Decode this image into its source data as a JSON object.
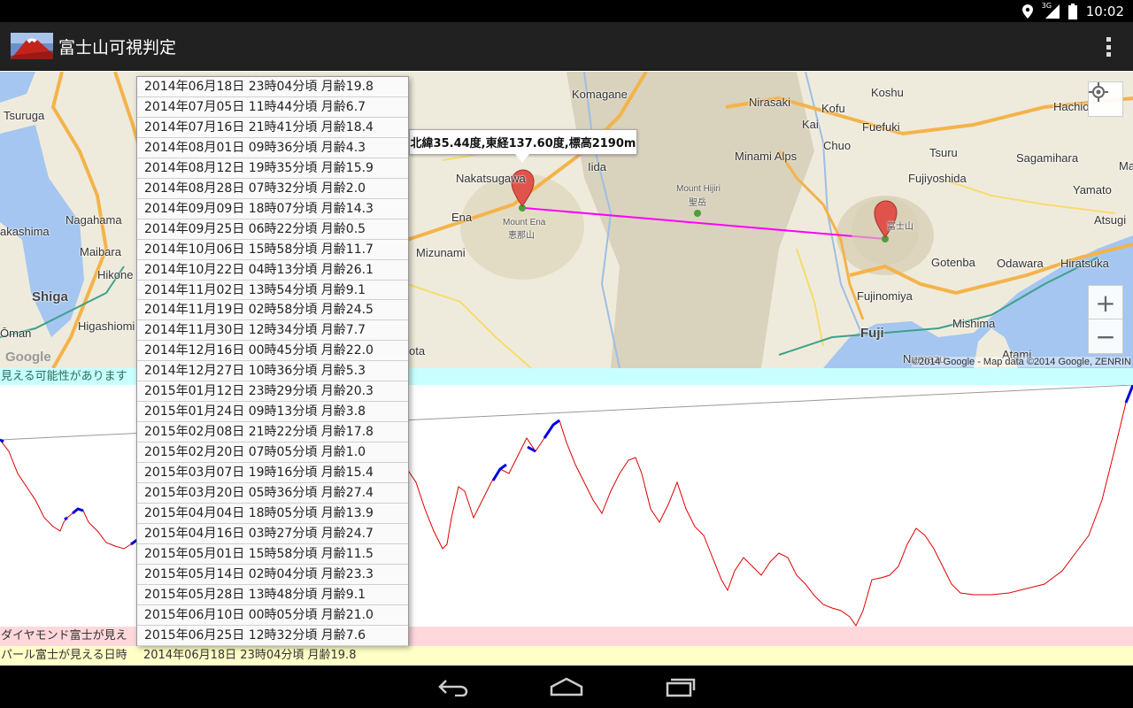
{
  "status_bar": {
    "time": "10:02",
    "network_label": "3G",
    "icons": [
      "location-icon",
      "signal-icon",
      "battery-icon"
    ]
  },
  "app_bar": {
    "title": "富士山可視判定",
    "icons": [
      "app-logo-icon",
      "overflow-menu-icon"
    ]
  },
  "map": {
    "info_window": "北緯35.44度,東経137.60度,標高2190m",
    "labels": {
      "tsuruga": "Tsuruga",
      "nagahama": "Nagahama",
      "akashima": "akashima",
      "maibara": "Maibara",
      "hikone": "Hikone",
      "shiga": "Shiga",
      "higashiomi": "Higashiomi",
      "oman": "Ōman",
      "komagane": "Komagane",
      "iida": "Iida",
      "nakatsugawa": "Nakatsugawa",
      "ena": "Ena",
      "mizunami": "Mizunami",
      "mount_ena": "Mount Ena",
      "mount_ena_jp": "恵那山",
      "ota": "ota",
      "nirasaki": "Nirasaki",
      "minami_alps": "Minami Alps",
      "mount_hijiri": "Mount Hijiri",
      "hijiri_jp": "聖岳",
      "koshu": "Koshu",
      "kofu": "Kofu",
      "fuefuki": "Fuefuki",
      "kai": "Kai",
      "chuo": "Chuo",
      "tsuru": "Tsuru",
      "fujiyoshida": "Fujiyoshida",
      "gotenba": "Gotenba",
      "fujinomiya": "Fujinomiya",
      "fuji": "Fuji",
      "numazu": "Numazu",
      "mishima": "Mishima",
      "atami": "Atami",
      "odawara": "Odawara",
      "hiratsuka": "Hiratsuka",
      "atsugi": "Atsugi",
      "yamato": "Yamato",
      "sagamihara": "Sagamihara",
      "hachio": "Hachio",
      "ma": "Ma",
      "mount_fuji_jp": "富士山"
    },
    "google_logo": "Google",
    "attribution": "©2014 Google - Map data ©2014 Google, ZENRIN",
    "zoom_in_label": "+",
    "zoom_out_label": "−",
    "accent_line_color": "#ff00ff"
  },
  "strips": {
    "visible": "見える可能性があります",
    "diamond": "ダイヤモンド富士が見え",
    "pearl_label": "パール富士が見える日時",
    "pearl_value": "2014年06月18日 23時04分頃 月齢19.8"
  },
  "dropdown_items": [
    "2014年06月18日 23時04分頃 月齢19.8",
    "2014年07月05日 11時44分頃 月齢6.7",
    "2014年07月16日 21時41分頃 月齢18.4",
    "2014年08月01日 09時36分頃 月齢4.3",
    "2014年08月12日 19時35分頃 月齢15.9",
    "2014年08月28日 07時32分頃 月齢2.0",
    "2014年09月09日 18時07分頃 月齢14.3",
    "2014年09月25日 06時22分頃 月齢0.5",
    "2014年10月06日 15時58分頃 月齢11.7",
    "2014年10月22日 04時13分頃 月齢26.1",
    "2014年11月02日 13時54分頃 月齢9.1",
    "2014年11月19日 02時58分頃 月齢24.5",
    "2014年11月30日 12時34分頃 月齢7.7",
    "2014年12月16日 00時45分頃 月齢22.0",
    "2014年12月27日 10時36分頃 月齢5.3",
    "2015年01月12日 23時29分頃 月齢20.3",
    "2015年01月24日 09時13分頃 月齢3.8",
    "2015年02月08日 21時22分頃 月齢17.8",
    "2015年02月20日 07時05分頃 月齢1.0",
    "2015年03月07日 19時16分頃 月齢15.4",
    "2015年03月20日 05時36分頃 月齢27.4",
    "2015年04月04日 18時05分頃 月齢13.9",
    "2015年04月16日 03時27分頃 月齢24.7",
    "2015年05月01日 15時58分頃 月齢11.5",
    "2015年05月14日 02時04分頃 月齢23.3",
    "2015年05月28日 13時48分頃 月齢9.1",
    "2015年06月10日 00時05分頃 月齢21.0",
    "2015年06月25日 12時32分頃 月齢7.6"
  ],
  "profile": {
    "terrain_color": "#e00000",
    "visible_color": "#0000dd",
    "sightline_color": "#999999"
  },
  "nav_bar": {
    "icons": [
      "back-icon",
      "home-icon",
      "recents-icon"
    ]
  }
}
